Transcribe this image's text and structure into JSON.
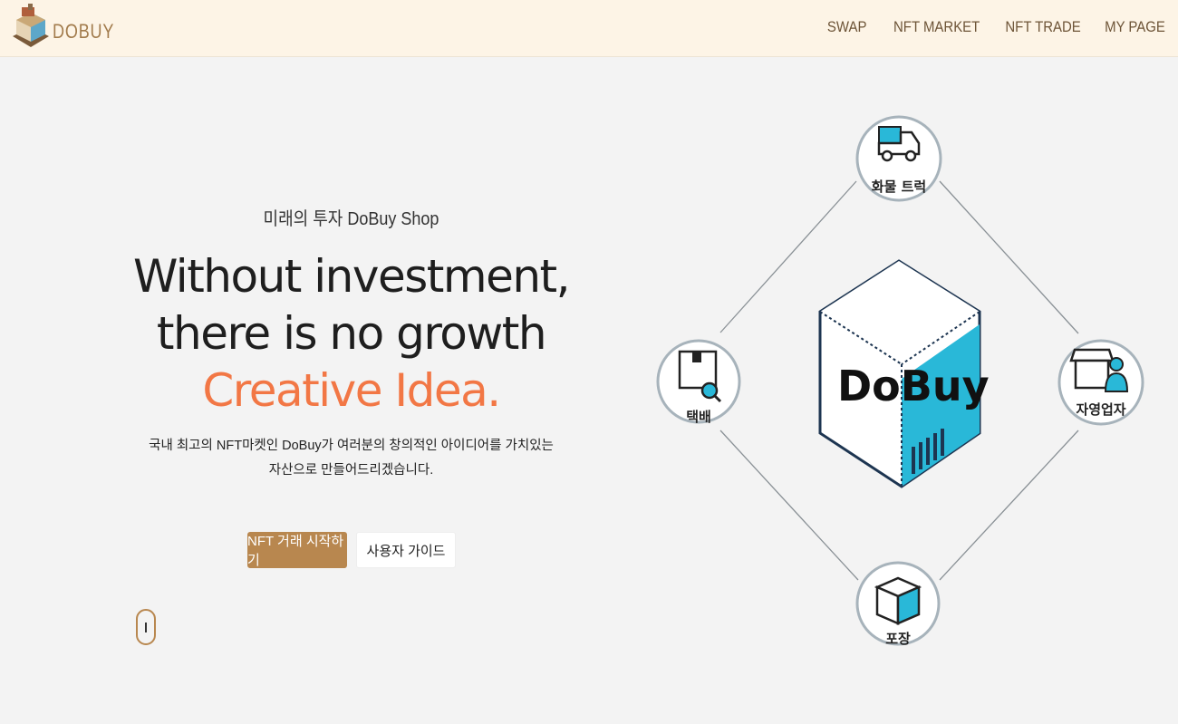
{
  "header": {
    "logo_text": "DOBUY",
    "nav": [
      "SWAP",
      "NFT MARKET",
      "NFT TRADE",
      "MY PAGE"
    ]
  },
  "hero": {
    "subtitle": "미래의 투자 DoBuy Shop",
    "headline_1": "Without investment,",
    "headline_2": "there is no growth",
    "headline_3": "Creative Idea.",
    "desc_1": "국내 최고의 NFT마켓인 DoBuy가 여러분의 창의적인 아이디어를 가치있는",
    "desc_2": "자산으로 만들어드리겠습니다.",
    "primary_button": "NFT 거래 시작하기",
    "secondary_button": "사용자 가이드"
  },
  "diagram": {
    "center_label": "DoBuy",
    "nodes": {
      "top": "화물 트럭",
      "left": "택배",
      "right": "자영업자",
      "bottom": "포장"
    }
  },
  "colors": {
    "header_bg": "#fdf4e6",
    "brand_brown": "#b8874f",
    "accent_orange": "#f27745",
    "cyan": "#29b8d8"
  }
}
